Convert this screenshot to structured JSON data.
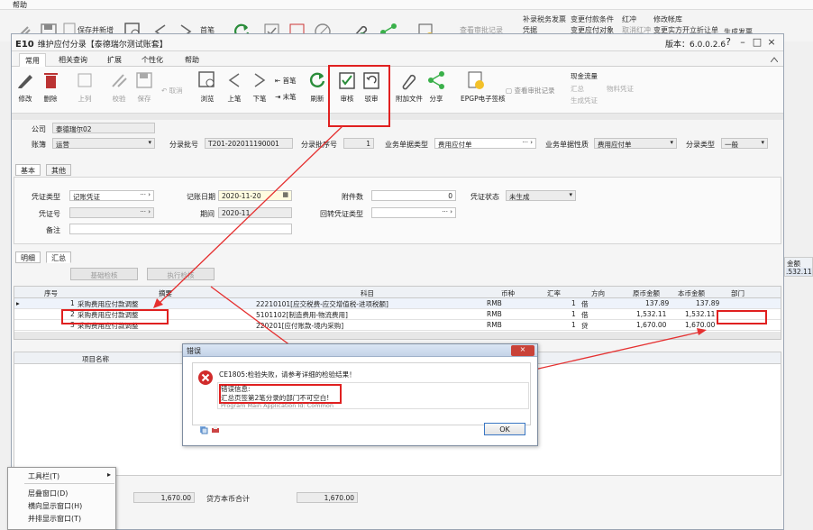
{
  "bg_menu": "帮助",
  "bg_toolbar": {
    "save_submit": "保存并新增",
    "first": "首笔",
    "quick_items": [
      "补录税务发票",
      "变更付款条件",
      "红冲",
      "修改帐库",
      "凭据",
      "变更应付对象",
      "取消红冲",
      "变更实方开立折让单",
      "生成发票",
      "查看审批记录"
    ]
  },
  "window": {
    "app_code": "E10",
    "title": "维护应付分录【泰德瑞尔测试账套】",
    "version": "版本：6.0.0.2.6",
    "controls": [
      "?",
      "–",
      "□",
      "×"
    ]
  },
  "ribbon_tabs": [
    "常用",
    "相关查询",
    "扩展",
    "个性化",
    "帮助"
  ],
  "ribbon": {
    "modify": "修改",
    "delete": "删除",
    "prev_record": "上列",
    "check": "校验",
    "save": "保存",
    "cancel": "取消",
    "browse": "浏览",
    "previous": "上笔",
    "next": "下笔",
    "first": "首笔",
    "last": "末笔",
    "refresh": "刷新",
    "approve": "审核",
    "unapprove": "驳审",
    "attach": "附加文件",
    "share": "分享",
    "epgp": "EPGP电子签核",
    "view_approval": "查看审批记录",
    "cash_flow": "现金流量",
    "summary": "汇总",
    "open_voucher": "物料凭证",
    "gen_voucher": "生成凭证"
  },
  "form": {
    "company_label": "公司",
    "company_value": "泰德瑞尔02",
    "ledger_label": "账簿",
    "ledger_value": "运营",
    "batch_label": "分录批号",
    "batch_value": "T201-202011190001",
    "seq_label": "分录批序号",
    "seq_value": "1",
    "biz_type_label": "业务单据类型",
    "biz_type_value": "费用应付单",
    "biz_nature_label": "业务单据性质",
    "biz_nature_value": "费用应付单",
    "entry_type_label": "分录类型",
    "entry_type_value": "一般"
  },
  "subtabs": [
    "基本",
    "其他"
  ],
  "voucher": {
    "type_label": "凭证类型",
    "type_value": "记账凭证",
    "date_label": "记账日期",
    "date_value": "2020-11-20",
    "attach_label": "附件数",
    "attach_value": "0",
    "status_label": "凭证状态",
    "status_value": "未生成",
    "no_label": "凭证号",
    "no_value": "",
    "period_label": "期间",
    "period_value": "2020-11",
    "reverse_label": "回转凭证类型",
    "reverse_value": "",
    "note_label": "备注",
    "note_value": ""
  },
  "grid_tabs": [
    "明细",
    "汇总"
  ],
  "grid_buttons": [
    "基础检核",
    "执行检核"
  ],
  "grid": {
    "headers": [
      "序号",
      "摘要",
      "科目",
      "币种",
      "汇率",
      "方向",
      "原币金额",
      "本币金额",
      "部门"
    ],
    "rows": [
      {
        "seq": "1",
        "summary": "采购费用应付款调整",
        "account": "22210101[应交税费-应交增值税-进项税额]",
        "currency": "RMB",
        "rate": "1",
        "dir": "借",
        "orig": "137.89",
        "local": "137.89",
        "dept": ""
      },
      {
        "seq": "2",
        "summary": "采购费用应付款调整",
        "account": "5101102[制造费用-物流费用]",
        "currency": "RMB",
        "rate": "1",
        "dir": "借",
        "orig": "1,532.11",
        "local": "1,532.11",
        "dept": ""
      },
      {
        "seq": "3",
        "summary": "采购费用应付款调整",
        "account": "220201[应付账款-境内采购]",
        "currency": "RMB",
        "rate": "1",
        "dir": "贷",
        "orig": "1,670.00",
        "local": "1,670.00",
        "dept": ""
      }
    ],
    "right_label": "金额",
    "right_value": ".532.11"
  },
  "lower": {
    "item_name": "项目名称",
    "total_value": "1,670.00",
    "local_total_label": "贷方本币合计",
    "local_total_value": "1,670.00"
  },
  "dialog": {
    "title": "错误",
    "close": "×",
    "message": "CE1805:检验失败，请参考详细的检验结果！",
    "detail_line1": "错误信息:",
    "detail_line2": "汇总页签第2笔分录的部门不可空白!",
    "detail_line3": "Program Main Application Id: Common",
    "ok": "OK"
  },
  "context_menu": [
    "工具栏(T)",
    "层叠窗口(D)",
    "横向显示窗口(H)",
    "并排显示窗口(T)"
  ],
  "colors": {
    "highlight": "#e02020",
    "accent": "#2e6fbf",
    "check_green": "#2a8c3a",
    "share_green": "#3ab04a"
  }
}
